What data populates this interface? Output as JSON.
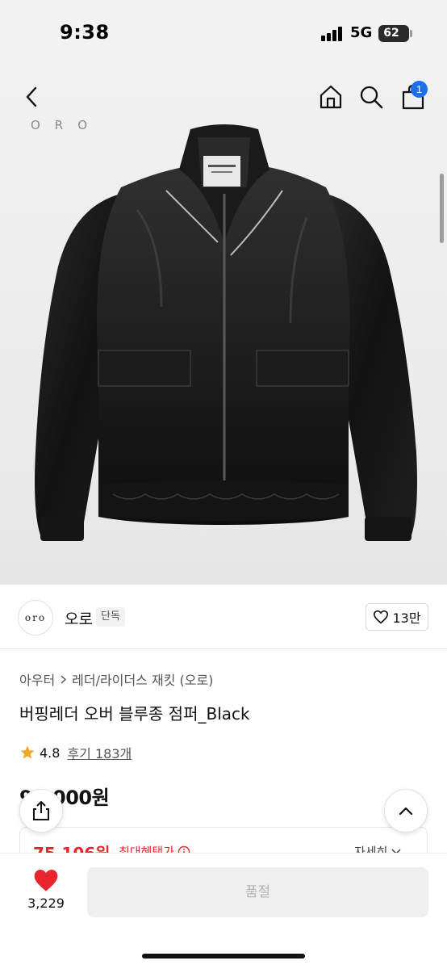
{
  "status_bar": {
    "time": "9:38",
    "network": "5G",
    "battery": "62"
  },
  "nav": {
    "back_icon": "chevron-left-icon",
    "home_icon": "home-icon",
    "search_icon": "search-icon",
    "cart_icon": "shopping-bag-icon",
    "cart_badge": "1"
  },
  "hero": {
    "brand_watermark": "ORO",
    "image": "black leather bomber jacket"
  },
  "brand": {
    "logo_text": "oro",
    "name": "오로",
    "tag": "단독",
    "likes": "13만"
  },
  "breadcrumb": {
    "category": "아우터",
    "subcategory": "레더/라이더스 재킷 (오로)"
  },
  "product": {
    "title": "버핑레더 오버 블루종 점퍼_Black",
    "rating": "4.8",
    "reviews": "후기 183개",
    "price": "94,000원"
  },
  "benefit": {
    "max_price": "75,106원",
    "label": "최대혜택가",
    "more": "자세히"
  },
  "bottom": {
    "like_count": "3,229",
    "cta": "품절"
  },
  "colors": {
    "accent_blue": "#1f6fe8",
    "price_red": "#e8262b",
    "heart_red": "#e8262b",
    "star_yellow": "#f5a623"
  }
}
